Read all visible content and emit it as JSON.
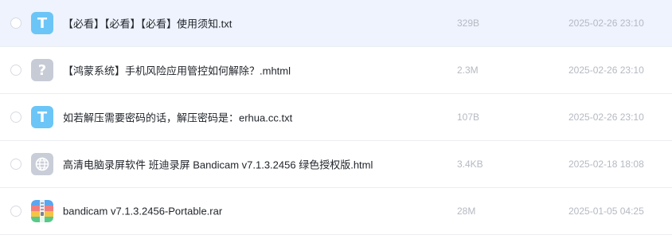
{
  "files": [
    {
      "icon": "text-file-icon",
      "glyph": "T",
      "name": "【必看】【必看】【必看】使用须知.txt",
      "size": "329B",
      "date": "2025-02-26 23:10",
      "hovered": true
    },
    {
      "icon": "unknown-file-icon",
      "glyph": "?",
      "name": "【鸿蒙系统】手机风险应用管控如何解除？.mhtml",
      "size": "2.3M",
      "date": "2025-02-26 23:10",
      "hovered": false
    },
    {
      "icon": "text-file-icon",
      "glyph": "T",
      "name": "如若解压需要密码的话，解压密码是：erhua.cc.txt",
      "size": "107B",
      "date": "2025-02-26 23:10",
      "hovered": false
    },
    {
      "icon": "web-file-icon",
      "glyph": "",
      "name": "高清电脑录屏软件 班迪录屏 Bandicam v7.1.3.2456 绿色授权版.html",
      "size": "3.4KB",
      "date": "2025-02-18 18:08",
      "hovered": false
    },
    {
      "icon": "archive-file-icon",
      "glyph": "",
      "name": "bandicam v7.1.3.2456-Portable.rar",
      "size": "28M",
      "date": "2025-01-05 04:25",
      "hovered": false
    }
  ],
  "colors": {
    "hover_row": "#eef3fd",
    "txt_icon": "#6cc5f7",
    "unknown_icon": "#c7cbd6",
    "meta_text": "#b5b9c2"
  }
}
